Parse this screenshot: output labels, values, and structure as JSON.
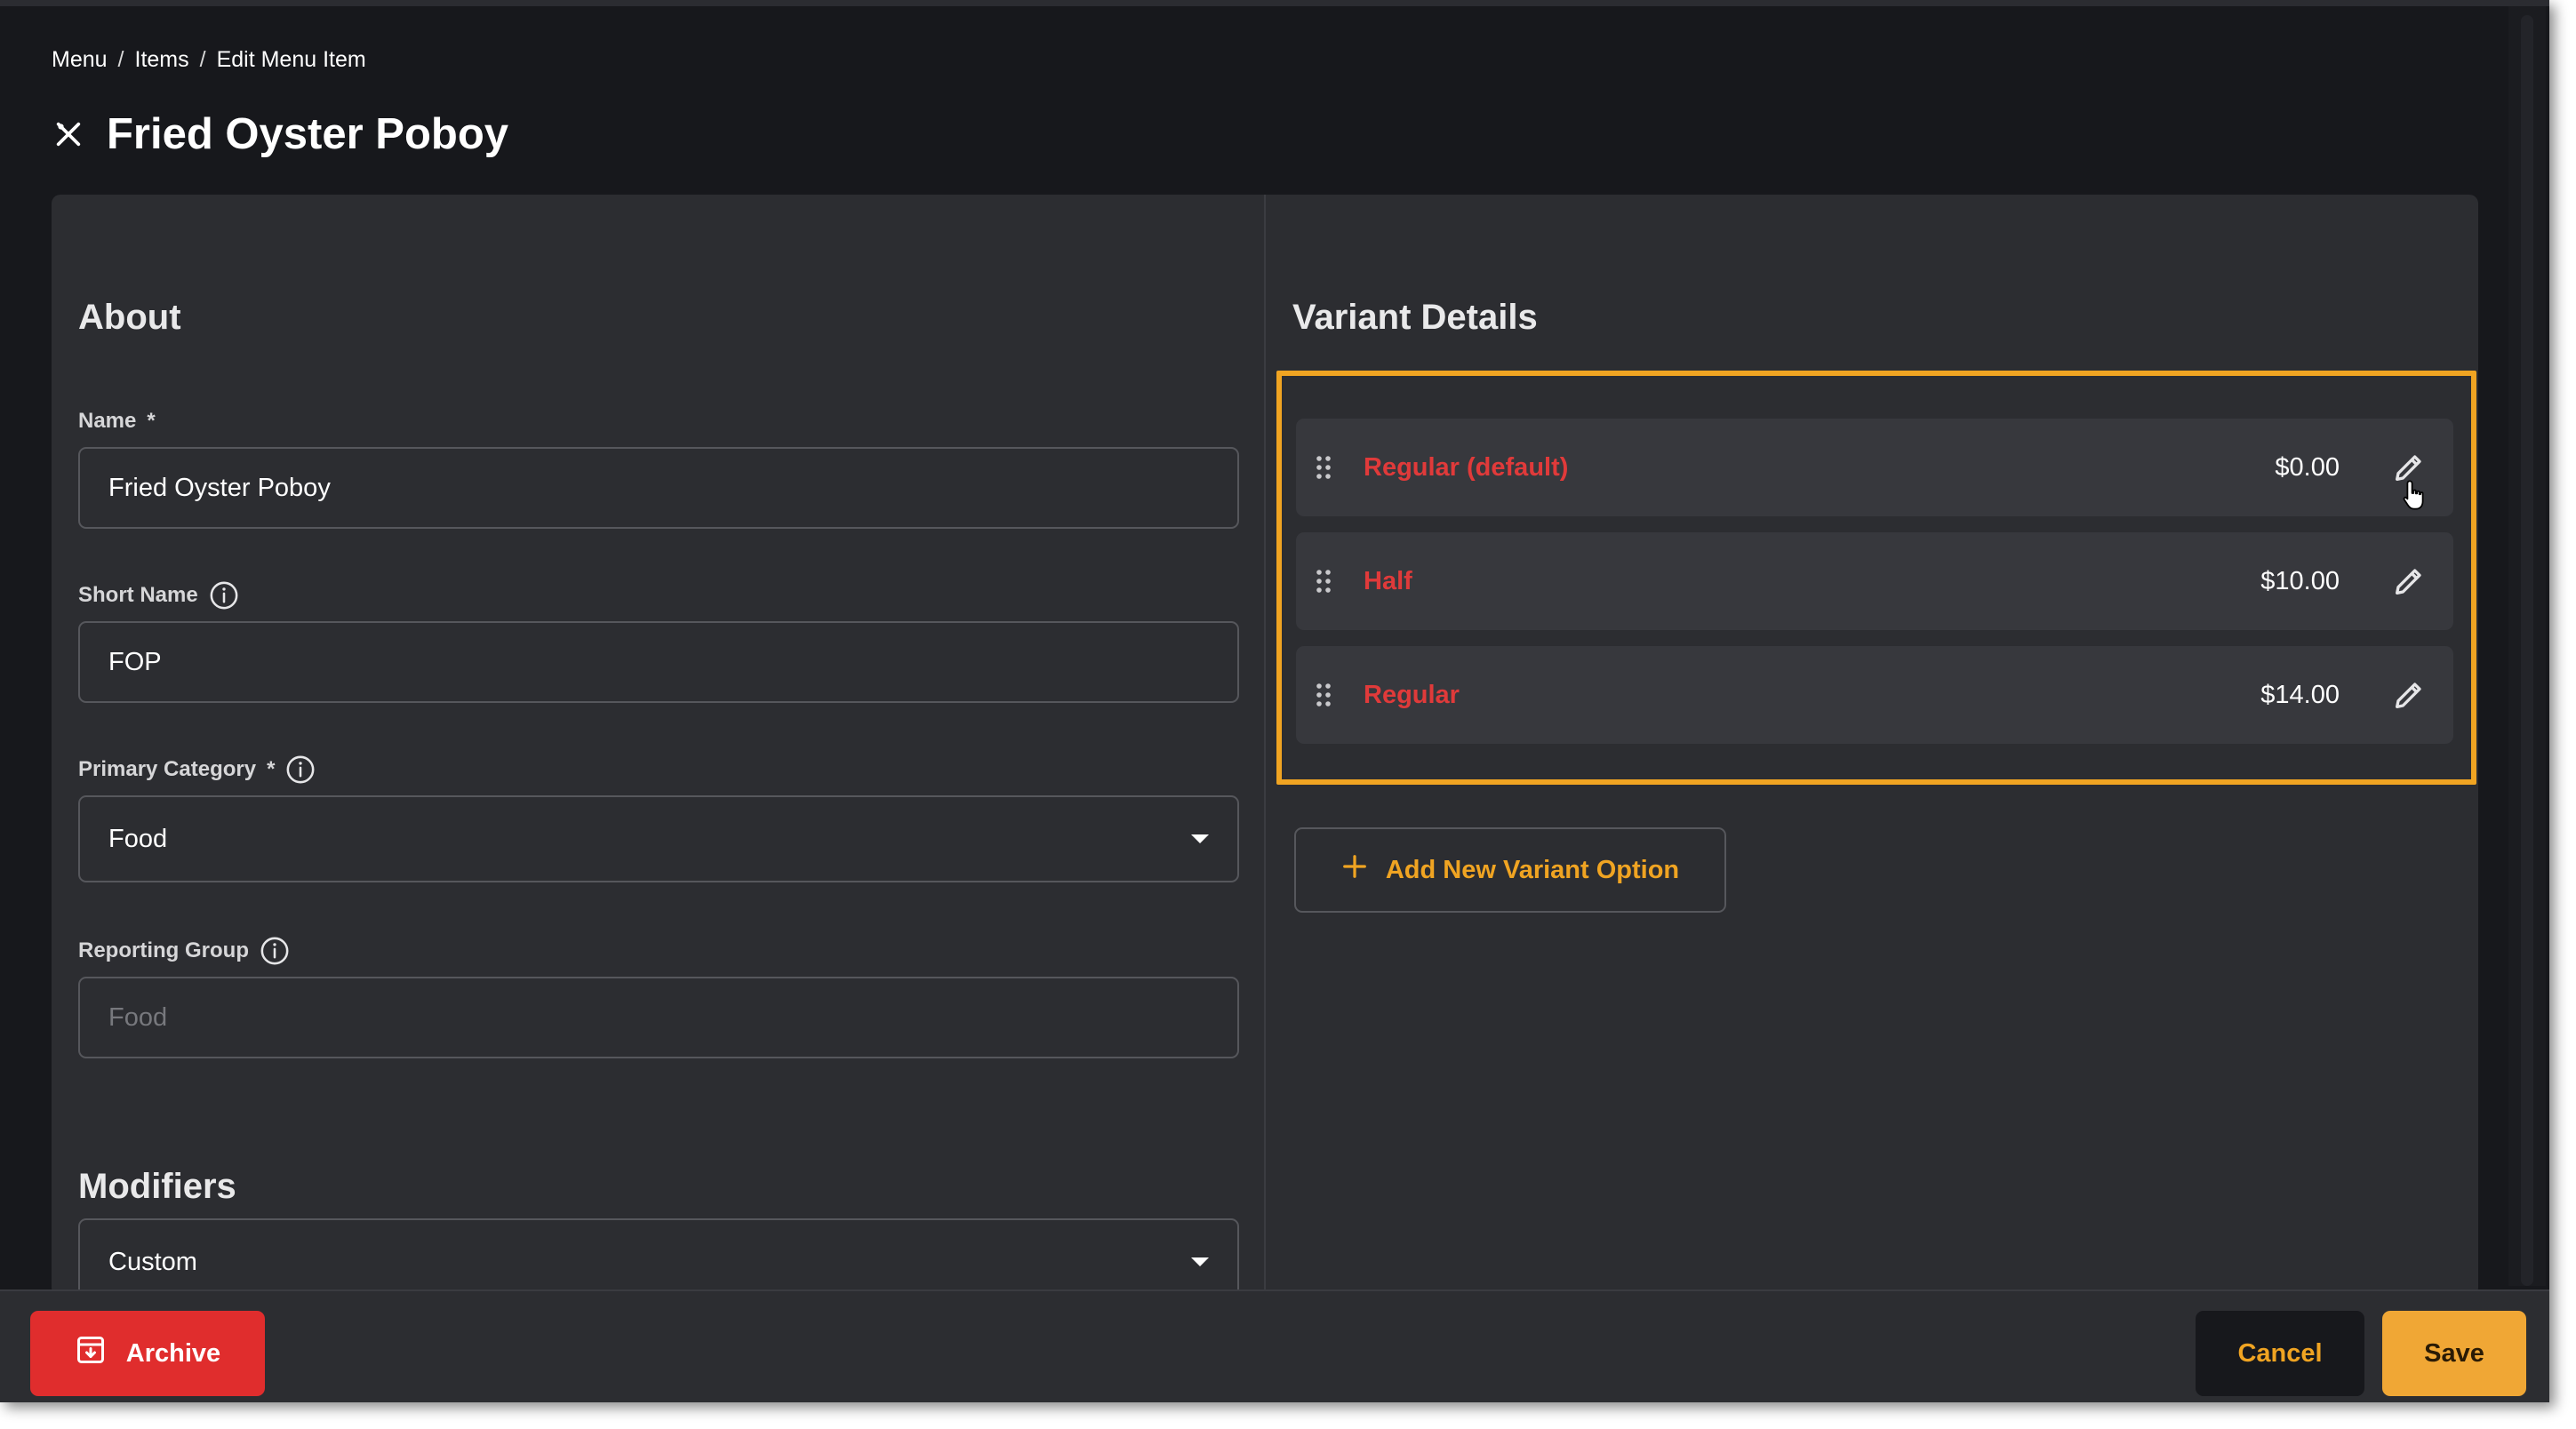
{
  "breadcrumb": {
    "items": [
      "Menu",
      "Items",
      "Edit Menu Item"
    ],
    "separator": "/"
  },
  "page": {
    "title": "Fried Oyster Poboy",
    "title_icon": "utensils-crossed-icon"
  },
  "about": {
    "heading": "About",
    "name": {
      "label": "Name",
      "required_mark": "*",
      "value": "Fried Oyster Poboy"
    },
    "short_name": {
      "label": "Short Name",
      "value": "FOP"
    },
    "primary_category": {
      "label": "Primary Category",
      "required_mark": "*",
      "value": "Food"
    },
    "reporting_group": {
      "label": "Reporting Group",
      "placeholder": "Food"
    }
  },
  "modifiers": {
    "heading": "Modifiers",
    "value": "Custom"
  },
  "variant_details": {
    "heading": "Variant Details",
    "variants": [
      {
        "name": "Regular (default)",
        "price": "$0.00"
      },
      {
        "name": "Half",
        "price": "$10.00"
      },
      {
        "name": "Regular",
        "price": "$14.00"
      }
    ],
    "add_button_label": "Add New Variant Option"
  },
  "footer": {
    "archive_label": "Archive",
    "cancel_label": "Cancel",
    "save_label": "Save"
  },
  "colors": {
    "background": "#17181c",
    "panel": "#2c2d31",
    "accent": "#f0a422",
    "variant_name": "#e03a3a",
    "archive": "#e02d2d"
  }
}
